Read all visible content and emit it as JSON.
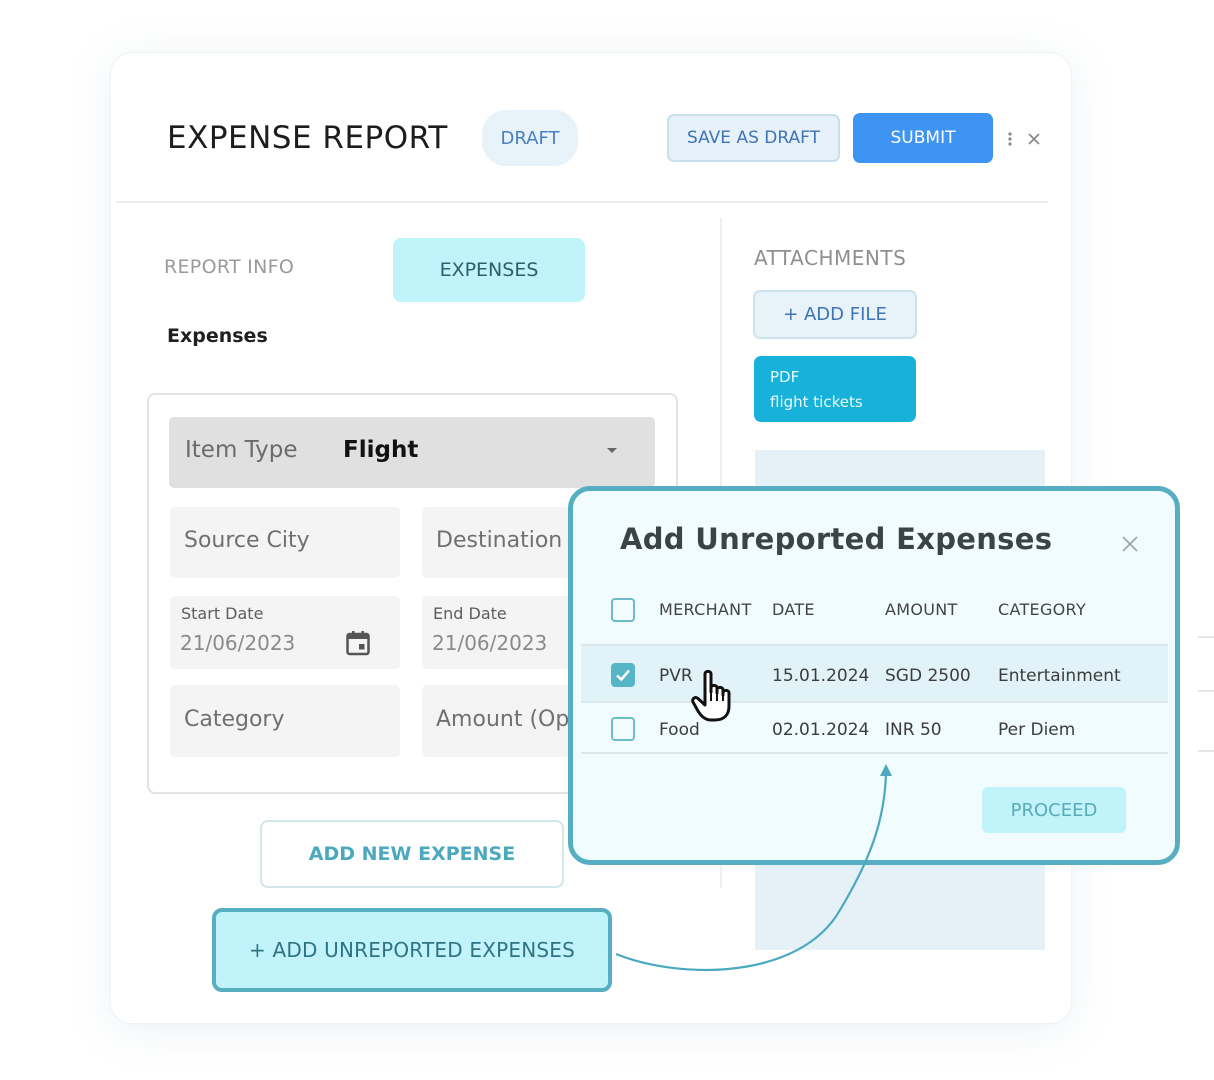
{
  "header": {
    "title": "EXPENSE REPORT",
    "status_badge": "DRAFT",
    "save_draft_label": "SAVE AS DRAFT",
    "submit_label": "SUBMIT",
    "more_icon": "kebab-vertical-icon",
    "close_icon": "close-icon"
  },
  "tabs": [
    {
      "label": "REPORT INFO",
      "active": false
    },
    {
      "label": "EXPENSES",
      "active": true
    }
  ],
  "section_title": "Expenses",
  "form": {
    "item_type": {
      "label": "Item Type",
      "value": "Flight"
    },
    "source_city": {
      "placeholder": "Source City"
    },
    "destination": {
      "placeholder": "Destination"
    },
    "start_date": {
      "label": "Start Date",
      "value": "21/06/2023"
    },
    "end_date": {
      "label": "End Date",
      "value": "21/06/2023"
    },
    "category": {
      "placeholder": "Category"
    },
    "amount": {
      "placeholder": "Amount (Op"
    }
  },
  "actions": {
    "add_new_expense": "ADD NEW EXPENSE",
    "add_unreported": "+ ADD UNREPORTED EXPENSES"
  },
  "attachments": {
    "title": "ATTACHMENTS",
    "add_file_label": "+ ADD FILE",
    "files": [
      {
        "type": "PDF",
        "name": "flight tickets"
      }
    ]
  },
  "modal": {
    "title": "Add Unreported Expenses",
    "columns": [
      "MERCHANT",
      "DATE",
      "AMOUNT",
      "CATEGORY"
    ],
    "rows": [
      {
        "merchant": "PVR",
        "date": "15.01.2024",
        "amount": "SGD 2500",
        "category": "Entertainment",
        "checked": true
      },
      {
        "merchant": "Food",
        "date": "02.01.2024",
        "amount": "INR 50",
        "category": "Per Diem",
        "checked": false
      }
    ],
    "proceed_label": "PROCEED"
  },
  "colors": {
    "accent_teal": "#57aec2",
    "submit_blue": "#3e94f3",
    "tab_active_bg": "#c1f3fb",
    "pdf_chip": "#17b1d9"
  }
}
